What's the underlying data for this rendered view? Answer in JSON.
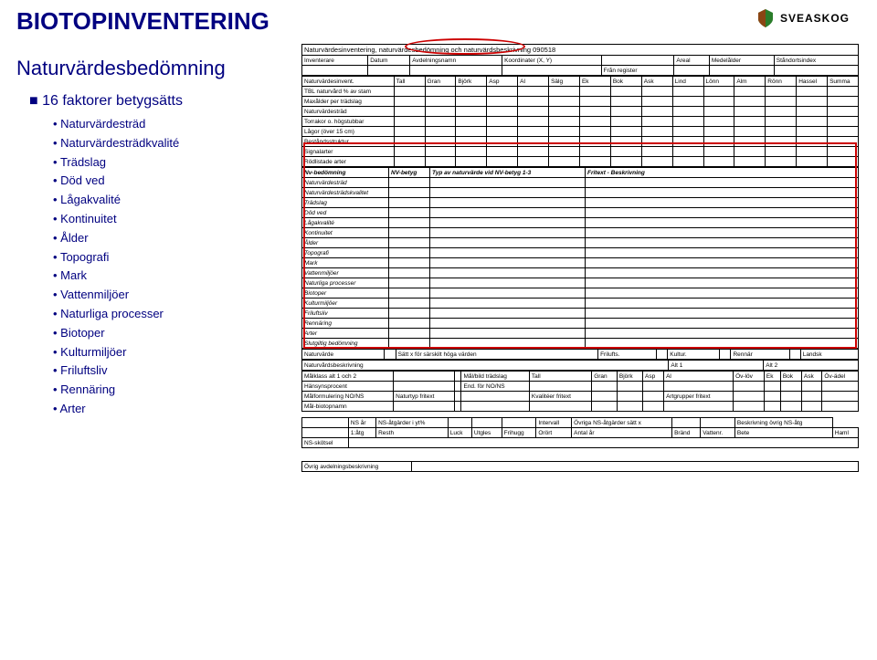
{
  "title": "BIOTOPINVENTERING",
  "subtitle": "Naturvärdesbedömning",
  "logo": "SVEASKOG",
  "main_bullet": "16 faktorer betygsätts",
  "factors": [
    "Naturvärdesträd",
    "Naturvärdesträdkvalité",
    "Trädslag",
    "Död ved",
    "Lågakvalité",
    "Kontinuitet",
    "Ålder",
    "Topografi",
    "Mark",
    "Vattenmiljöer",
    "Naturliga processer",
    "Biotoper",
    "Kulturmiljöer",
    "Friluftsliv",
    "Rennäring",
    "Arter"
  ],
  "form_title": "Naturvärdesinventering, naturvärdesbedömning och naturvärdsbeskrivning 090518",
  "hdr1": [
    "Inventerare",
    "Datum",
    "Avdelningsnamn",
    "Koordinater (X, Y)",
    "",
    "Areal",
    "Medelålder",
    "Ståndortsindex"
  ],
  "hdr1b": "Från register",
  "species_hdr": [
    "Naturvärdesinvent.",
    "Tall",
    "Gran",
    "Björk",
    "Asp",
    "Al",
    "Sälg",
    "Ek",
    "Bok",
    "Ask",
    "Lind",
    "Lönn",
    "Alm",
    "Rönn",
    "Hassel",
    "Summa"
  ],
  "species_rows": [
    "TBL naturvård % av stam",
    "Maxålder per trädslag",
    "Naturvärdesträd",
    "Torrakor o. högstubbar",
    "Lågor (över 15 cm)",
    "Beståndsstruktur.",
    "Signalarter",
    "Rödlistade arter"
  ],
  "nv_hdr": [
    "Nv-bedömning",
    "NV-betyg",
    "Typ av naturvärde vid NV-betyg 1-3",
    "Fritext - Beskrivning"
  ],
  "nv_rows": [
    "Naturvärdesträd",
    "Naturvärdesträdskvalitet",
    "Trädslag",
    "Död ved",
    "Lågakvalité",
    "Kontinuitet",
    "Ålder",
    "Topografi",
    "Mark",
    "Vattenmiljöer",
    "Naturliga processer",
    "Biotoper",
    "Kulturmiljöer",
    "Friluftsliv",
    "Rennäring",
    "Arter",
    "Slutgiltig bedömning"
  ],
  "nvline": [
    "Naturvärde",
    "",
    "Sätt x för särskilt höga värden",
    "Frilufts.",
    "",
    "Kultur.",
    "",
    "Rennär",
    "",
    "Landsk"
  ],
  "beskr_hdr": [
    "Naturvårdsbeskrivning",
    "Alt 1",
    "Alt 2"
  ],
  "mal_rows": {
    "r1": [
      "Målklass alt 1 och 2",
      "",
      "",
      "Mål/bild trädslag",
      "Tall",
      "Gran",
      "Björk",
      "Asp",
      "Al",
      "Öv-löv",
      "Ek",
      "Bok",
      "Ask",
      "Öv-ädel"
    ],
    "r2": [
      "Hänsynsprocent",
      "",
      "",
      "End. för NO/NS",
      "",
      "",
      "",
      "",
      "",
      "",
      "",
      "",
      "",
      ""
    ],
    "r3": [
      "Målformulering NO/NS",
      "Naturtyp fritext",
      "",
      "",
      "Kvalitéer fritext",
      "",
      "",
      "",
      "Artgrupper fritext",
      "",
      "",
      "",
      "",
      ""
    ],
    "r4": [
      "Mål-biotopnamn",
      "",
      "",
      "",
      "",
      "",
      "",
      "",
      "",
      "",
      "",
      "",
      "",
      ""
    ]
  },
  "ns_hdr": [
    "",
    "NS år",
    "NS-åtgärder i yt%",
    "",
    "",
    "",
    "Intervall",
    "Övriga NS-åtgärder sätt x",
    "",
    "",
    "Beskrivning övrig NS-åtg"
  ],
  "ns_row": [
    "",
    "1:åtg",
    "Resth",
    "Luck",
    "Utgles",
    "Frihugg",
    "Orört",
    "Antal år",
    "Bränd",
    "Vattenr.",
    "Bete",
    "Haml"
  ],
  "ns_sk": "NS-skötsel",
  "ovrig": "Övrig avdelningsbeskrivning"
}
